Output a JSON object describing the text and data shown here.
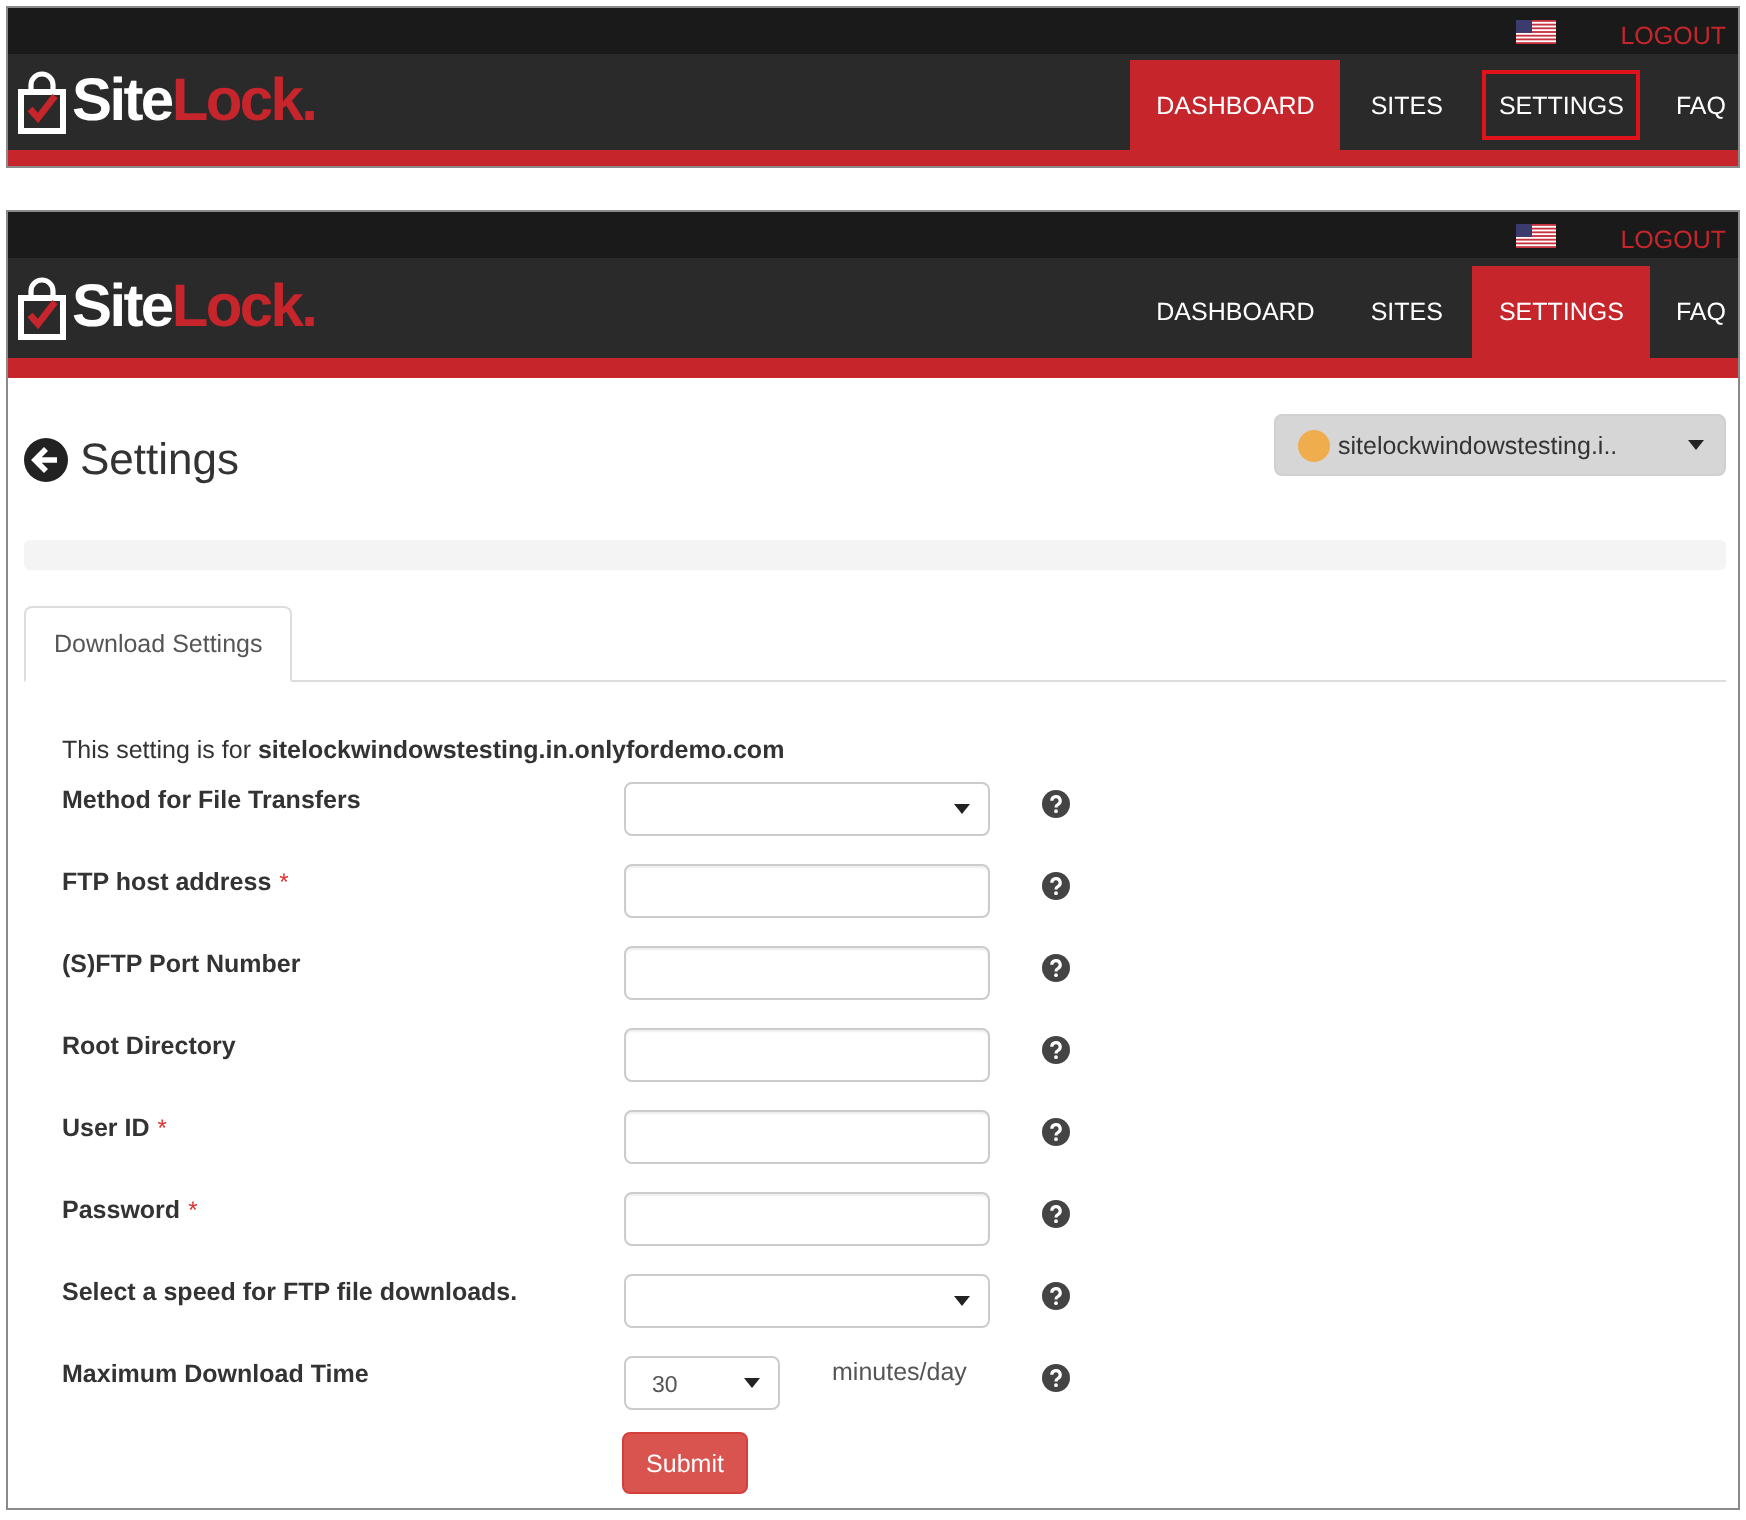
{
  "header_screenshot": {
    "logo": {
      "text": "Site",
      "accent": "Lock."
    },
    "logout": "LOGOUT",
    "nav": [
      {
        "label": "DASHBOARD",
        "selected": true,
        "highlighted": false
      },
      {
        "label": "SITES",
        "selected": false,
        "highlighted": false
      },
      {
        "label": "SETTINGS",
        "selected": false,
        "highlighted": true
      },
      {
        "label": "FAQ",
        "selected": false,
        "highlighted": false
      }
    ]
  },
  "settings_screenshot": {
    "header": {
      "logo": {
        "text": "Site",
        "accent": "Lock."
      },
      "logout": "LOGOUT",
      "nav": [
        {
          "label": "DASHBOARD",
          "selected": false
        },
        {
          "label": "SITES",
          "selected": false
        },
        {
          "label": "SETTINGS",
          "selected": true
        },
        {
          "label": "FAQ",
          "selected": false
        }
      ]
    },
    "page": {
      "title": "Settings",
      "site_selector": "sitelockwindowstesting.i..",
      "tabs": [
        {
          "label": "Download Settings",
          "selected": true
        }
      ],
      "intro": "This setting is for **sitelockwindowstesting.in.onlyfordemo.com**",
      "fields": [
        {
          "kind": "select",
          "label": "Method for File Transfers"
        },
        {
          "kind": "text",
          "label": "FTP host address",
          "required_mark": "*"
        },
        {
          "kind": "text",
          "label": "(S)FTP Port Number"
        },
        {
          "kind": "text",
          "label": "Root Directory"
        },
        {
          "kind": "text",
          "label": "User ID",
          "required_mark": "*"
        },
        {
          "kind": "text",
          "label": "Password",
          "required_mark": "*"
        },
        {
          "kind": "select",
          "label": "Select a speed for FTP file downloads."
        },
        {
          "kind": "short_select",
          "label": "Maximum Download Time",
          "value": "30",
          "unit": "minutes/day"
        }
      ],
      "submit": "Submit"
    }
  }
}
